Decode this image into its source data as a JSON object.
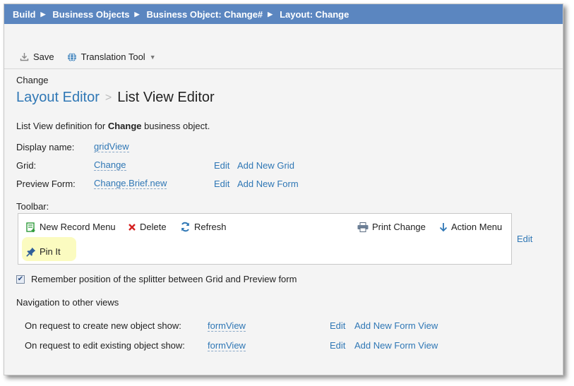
{
  "breadcrumb": [
    "Build",
    "Business Objects",
    "Business Object: Change#",
    "Layout: Change"
  ],
  "toolbar": {
    "save_label": "Save",
    "translation_label": "Translation Tool"
  },
  "object_name": "Change",
  "title": {
    "parent": "Layout Editor",
    "separator": ">",
    "current": "List View Editor"
  },
  "description": {
    "prefix": "List View definition for ",
    "object": "Change",
    "suffix": " business object."
  },
  "fields": {
    "display_name": {
      "label": "Display name:",
      "value": "gridView"
    },
    "grid": {
      "label": "Grid:",
      "value": "Change",
      "edit": "Edit",
      "add": "Add New Grid"
    },
    "preview_form": {
      "label": "Preview Form:",
      "value": "Change.Brief.new",
      "edit": "Edit",
      "add": "Add New Form"
    }
  },
  "grid_toolbar": {
    "label": "Toolbar:",
    "items": [
      "New Record Menu",
      "Delete",
      "Refresh",
      "Print Change",
      "Action Menu",
      "Pin It"
    ],
    "edit": "Edit"
  },
  "splitter": {
    "checked": true,
    "label": "Remember position of the splitter between Grid and Preview form"
  },
  "navigation": {
    "heading": "Navigation to other views",
    "rows": [
      {
        "label": "On request to create new object show:",
        "value": "formView",
        "edit": "Edit",
        "add": "Add New Form View"
      },
      {
        "label": "On request to edit existing object show:",
        "value": "formView",
        "edit": "Edit",
        "add": "Add New Form View"
      }
    ]
  },
  "colors": {
    "header_bar": "#5b86c0",
    "link": "#2f77b5",
    "highlight": "#fbfbc0",
    "delete": "#d42020",
    "new_record": "#2e9a3a"
  }
}
